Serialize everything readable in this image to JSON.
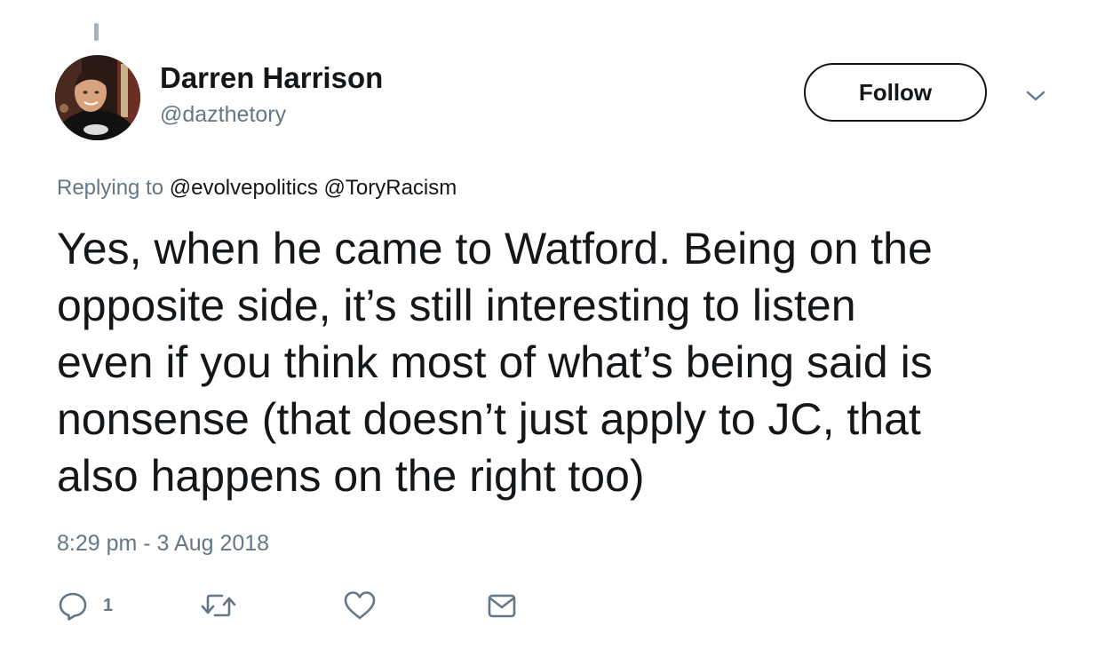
{
  "author": {
    "name": "Darren Harrison",
    "handle": "@dazthetory"
  },
  "follow_label": "Follow",
  "reply_context": {
    "prefix": "Replying to",
    "mentions": [
      "@evolvepolitics",
      "@ToryRacism"
    ]
  },
  "tweet": {
    "lines": [
      "Yes, when he came to Watford. Being on the",
      "opposite side, it’s still interesting to listen",
      "even if you think most of what’s being said is",
      "nonsense (that doesn’t just apply to JC, that",
      "also happens on the right too)"
    ],
    "timestamp": "8:29 pm - 3 Aug 2018"
  },
  "actions": {
    "reply_count": "1"
  },
  "icons": {
    "caret": "chevron-down-icon",
    "reply": "reply-icon",
    "retweet": "retweet-icon",
    "like": "heart-icon",
    "message": "envelope-icon"
  },
  "colors": {
    "text_primary": "#14171a",
    "text_secondary": "#657786",
    "icon": "#657786"
  }
}
